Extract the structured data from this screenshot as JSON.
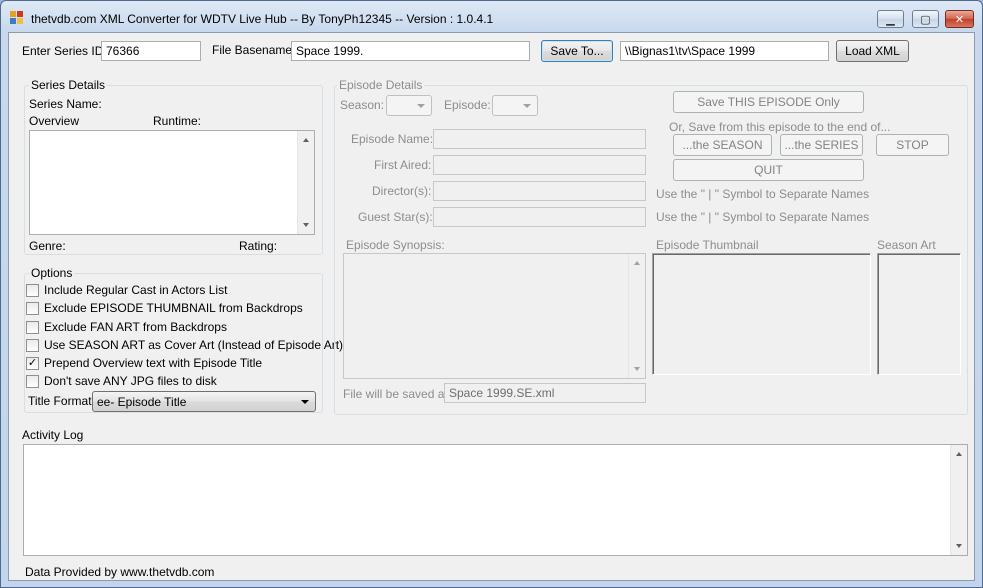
{
  "window": {
    "title": "thetvdb.com XML Converter for WDTV Live Hub -- By TonyPh12345 -- Version : 1.0.4.1",
    "controls": {
      "minimize": "▁",
      "maximize": "▢",
      "close": "✕"
    }
  },
  "top_bar": {
    "series_id_label": "Enter Series ID",
    "series_id_value": "76366",
    "basename_label": "File Basename",
    "basename_value": "Space 1999.",
    "save_to_label": "Save To...",
    "path_value": "\\\\Bignas1\\tv\\Space 1999",
    "load_xml_label": "Load XML"
  },
  "series_details": {
    "title": "Series Details",
    "series_name_label": "Series Name:",
    "overview_label": "Overview",
    "runtime_label": "Runtime:",
    "genre_label": "Genre:",
    "rating_label": "Rating:"
  },
  "options": {
    "title": "Options",
    "items": [
      {
        "label": "Include Regular Cast in Actors List",
        "checked": false
      },
      {
        "label": "Exclude EPISODE THUMBNAIL from Backdrops",
        "checked": false
      },
      {
        "label": "Exclude FAN ART from Backdrops",
        "checked": false
      },
      {
        "label": "Use SEASON ART as Cover Art (Instead of Episode Art)",
        "checked": false
      },
      {
        "label": "Prepend Overview text with Episode Title",
        "checked": true
      },
      {
        "label": "Don't save ANY JPG files to disk",
        "checked": false
      }
    ],
    "title_format_label": "Title Format :",
    "title_format_value": "ee- Episode Title"
  },
  "episode_details": {
    "title": "Episode Details",
    "season_label": "Season:",
    "episode_label": "Episode:",
    "save_this_episode_label": "Save THIS EPISODE Only",
    "save_range_label": "Or, Save from this episode to the end of...",
    "the_season_label": "...the SEASON",
    "the_series_label": "...the SERIES",
    "stop_label": "STOP",
    "quit_label": "QUIT",
    "episode_name_label": "Episode Name:",
    "first_aired_label": "First Aired:",
    "directors_label": "Director(s):",
    "guest_stars_label": "Guest Star(s):",
    "separator_hint_1": "Use the \" | \" Symbol to Separate Names",
    "separator_hint_2": "Use the \" | \" Symbol to Separate Names",
    "synopsis_label": "Episode Synopsis:",
    "thumbnail_label": "Episode Thumbnail",
    "season_art_label": "Season Art",
    "saved_as_label": "File will be saved as:",
    "saved_as_value": "Space 1999.SE.xml"
  },
  "activity_log": {
    "title": "Activity Log"
  },
  "footer": {
    "credit": "Data Provided by www.thetvdb.com"
  }
}
